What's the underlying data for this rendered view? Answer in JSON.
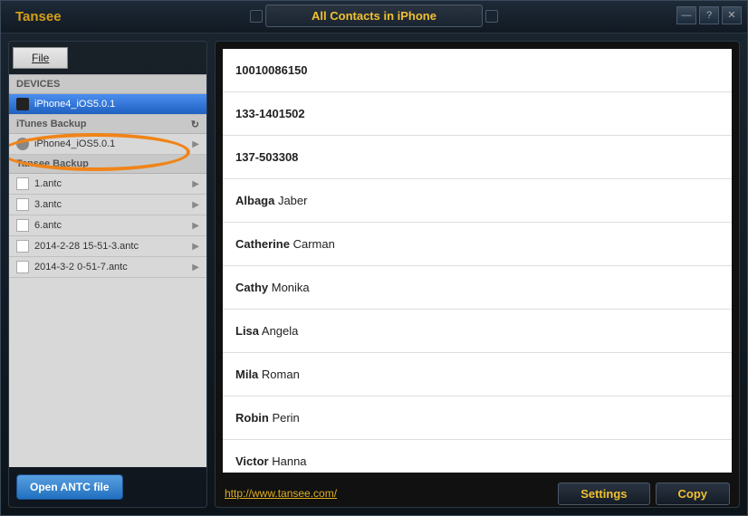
{
  "app_name": "Tansee",
  "window_title": "All Contacts in iPhone",
  "file_menu_label": "File",
  "sidebar": {
    "sections": [
      {
        "label": "DEVICES",
        "items": [
          {
            "label": "iPhone4_iOS5.0.1",
            "icon": "phone",
            "selected": true
          }
        ]
      },
      {
        "label": "iTunes Backup",
        "refresh": true,
        "items": [
          {
            "label": "iPhone4_iOS5.0.1",
            "icon": "backup",
            "chevron": true
          }
        ]
      },
      {
        "label": "Tansee Backup",
        "items": [
          {
            "label": "1.antc",
            "icon": "file",
            "chevron": true
          },
          {
            "label": "3.antc",
            "icon": "file",
            "chevron": true
          },
          {
            "label": "6.antc",
            "icon": "file",
            "chevron": true
          },
          {
            "label": "2014-2-28 15-51-3.antc",
            "icon": "file",
            "chevron": true
          },
          {
            "label": "2014-3-2 0-51-7.antc",
            "icon": "file",
            "chevron": true
          }
        ]
      }
    ],
    "open_button": "Open ANTC file"
  },
  "contacts": [
    {
      "first": "10010086150",
      "last": ""
    },
    {
      "first": "133-1401502",
      "last": ""
    },
    {
      "first": "137-503308",
      "last": ""
    },
    {
      "first": "Albaga",
      "last": "Jaber"
    },
    {
      "first": "Catherine",
      "last": "Carman"
    },
    {
      "first": "Cathy",
      "last": "Monika"
    },
    {
      "first": "Lisa",
      "last": "Angela"
    },
    {
      "first": "Mila",
      "last": "Roman"
    },
    {
      "first": "Robin",
      "last": "Perin"
    },
    {
      "first": "Victor",
      "last": "Hanna"
    }
  ],
  "footer": {
    "url": "http://www.tansee.com/",
    "settings_label": "Settings",
    "copy_label": "Copy"
  },
  "window_controls": {
    "minimize": "—",
    "help": "?",
    "close": "✕"
  }
}
